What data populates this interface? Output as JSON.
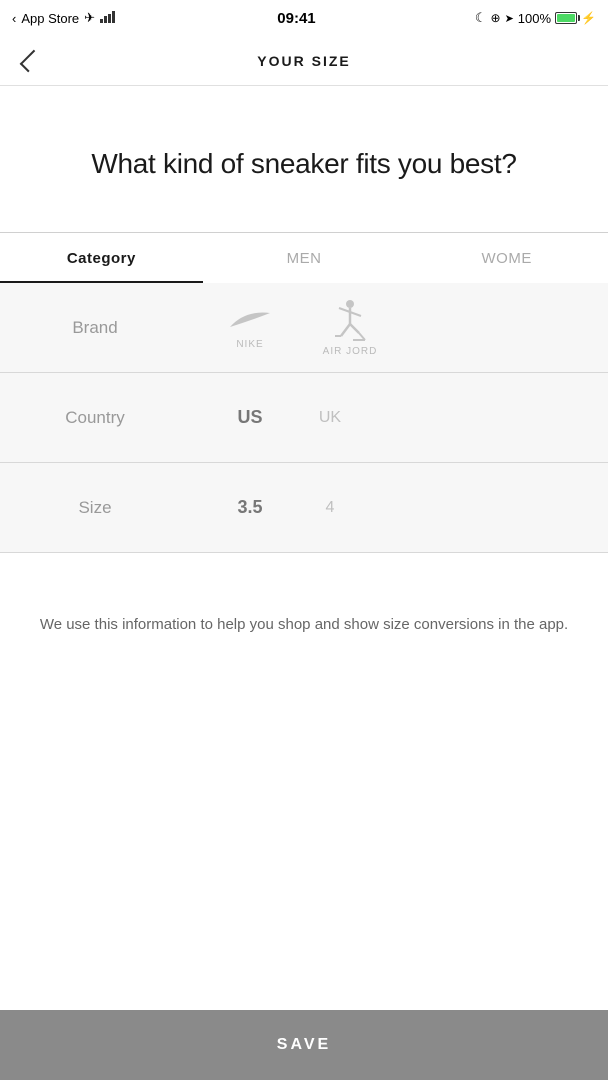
{
  "status_bar": {
    "carrier": "App Store",
    "time": "09:41",
    "battery_percent": "100%"
  },
  "nav": {
    "title": "YOUR SIZE",
    "back_label": "back"
  },
  "hero": {
    "question": "What kind of sneaker fits you best?"
  },
  "tabs": [
    {
      "id": "category",
      "label": "Category",
      "active": true
    },
    {
      "id": "men",
      "label": "MEN",
      "active": false
    },
    {
      "id": "women",
      "label": "WOME",
      "active": false
    }
  ],
  "pickers": [
    {
      "id": "brand",
      "label": "Brand",
      "values": [
        "NIKE",
        "AIR JORD"
      ]
    },
    {
      "id": "country",
      "label": "Country",
      "values": [
        "US",
        "UK"
      ]
    },
    {
      "id": "size",
      "label": "Size",
      "values": [
        "3.5",
        "4"
      ]
    }
  ],
  "info": {
    "text": "We use this information to help you shop and show size conversions in the app."
  },
  "save_button": {
    "label": "SAVE"
  }
}
